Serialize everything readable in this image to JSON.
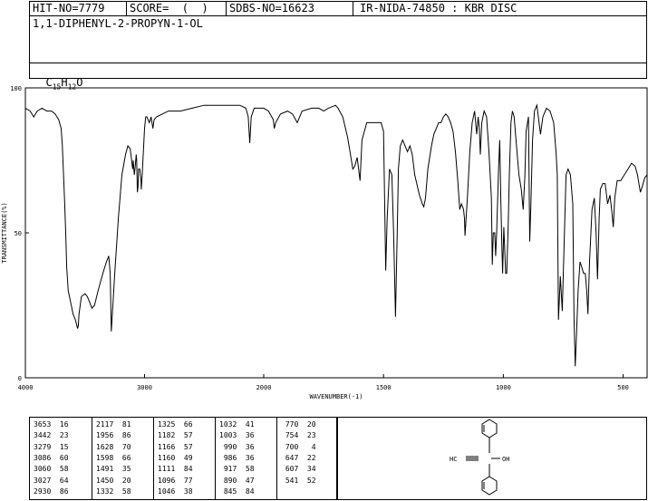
{
  "header": {
    "hit_no": "HIT-NO=7779",
    "score": "SCORE=  (  )",
    "sdbs_no": "SDBS-NO=16623",
    "method": "IR-NIDA-74850 : KBR DISC",
    "compound_name": "1,1-DIPHENYL-2-PROPYN-1-OL",
    "formula_parts": [
      "C",
      "15",
      "H",
      "12",
      "O"
    ]
  },
  "chart_data": {
    "type": "line",
    "xlabel": "WAVENUMBER(-1)",
    "ylabel": "TRANSMITTANCE(%)",
    "xlim": [
      4000,
      400
    ],
    "ylim": [
      0,
      100
    ],
    "x_ticks": [
      "4000",
      "3000",
      "2000",
      "1500",
      "1000",
      "500"
    ],
    "y_ticks": [
      "100",
      "50",
      "0"
    ],
    "series": [
      {
        "points": [
          [
            4000,
            93
          ],
          [
            3960,
            92
          ],
          [
            3930,
            90
          ],
          [
            3900,
            92
          ],
          [
            3860,
            93
          ],
          [
            3820,
            92
          ],
          [
            3780,
            92
          ],
          [
            3750,
            91
          ],
          [
            3720,
            89
          ],
          [
            3700,
            86
          ],
          [
            3690,
            80
          ],
          [
            3680,
            70
          ],
          [
            3670,
            60
          ],
          [
            3660,
            48
          ],
          [
            3653,
            38
          ],
          [
            3640,
            30
          ],
          [
            3620,
            26
          ],
          [
            3600,
            22
          ],
          [
            3580,
            20
          ],
          [
            3568,
            18
          ],
          [
            3562,
            17
          ],
          [
            3556,
            18
          ],
          [
            3550,
            22
          ],
          [
            3530,
            28
          ],
          [
            3500,
            29
          ],
          [
            3480,
            28
          ],
          [
            3460,
            26
          ],
          [
            3442,
            24
          ],
          [
            3420,
            25
          ],
          [
            3390,
            30
          ],
          [
            3350,
            36
          ],
          [
            3320,
            40
          ],
          [
            3300,
            42
          ],
          [
            3288,
            36
          ],
          [
            3279,
            16
          ],
          [
            3270,
            22
          ],
          [
            3250,
            36
          ],
          [
            3220,
            55
          ],
          [
            3190,
            70
          ],
          [
            3160,
            77
          ],
          [
            3140,
            80
          ],
          [
            3120,
            79
          ],
          [
            3100,
            72
          ],
          [
            3095,
            75
          ],
          [
            3086,
            70
          ],
          [
            3078,
            73
          ],
          [
            3070,
            77
          ],
          [
            3066,
            75
          ],
          [
            3060,
            64
          ],
          [
            3055,
            66
          ],
          [
            3050,
            72
          ],
          [
            3040,
            72
          ],
          [
            3030,
            68
          ],
          [
            3027,
            65
          ],
          [
            3020,
            70
          ],
          [
            3010,
            78
          ],
          [
            3000,
            86
          ],
          [
            2990,
            90
          ],
          [
            2980,
            90
          ],
          [
            2960,
            88
          ],
          [
            2945,
            90
          ],
          [
            2930,
            86
          ],
          [
            2920,
            89
          ],
          [
            2900,
            90
          ],
          [
            2850,
            91
          ],
          [
            2800,
            92
          ],
          [
            2700,
            92
          ],
          [
            2600,
            93
          ],
          [
            2500,
            94
          ],
          [
            2400,
            94
          ],
          [
            2300,
            94
          ],
          [
            2200,
            94
          ],
          [
            2150,
            93
          ],
          [
            2130,
            90
          ],
          [
            2117,
            81
          ],
          [
            2105,
            90
          ],
          [
            2080,
            93
          ],
          [
            2050,
            93
          ],
          [
            2000,
            93
          ],
          [
            1980,
            92
          ],
          [
            1960,
            89
          ],
          [
            1956,
            86
          ],
          [
            1950,
            88
          ],
          [
            1930,
            91
          ],
          [
            1900,
            92
          ],
          [
            1880,
            91
          ],
          [
            1860,
            88
          ],
          [
            1840,
            92
          ],
          [
            1800,
            93
          ],
          [
            1770,
            93
          ],
          [
            1750,
            92
          ],
          [
            1730,
            93
          ],
          [
            1700,
            94
          ],
          [
            1690,
            93
          ],
          [
            1670,
            90
          ],
          [
            1650,
            83
          ],
          [
            1640,
            78
          ],
          [
            1628,
            72
          ],
          [
            1620,
            73
          ],
          [
            1610,
            76
          ],
          [
            1598,
            68
          ],
          [
            1590,
            82
          ],
          [
            1570,
            88
          ],
          [
            1540,
            88
          ],
          [
            1510,
            88
          ],
          [
            1500,
            85
          ],
          [
            1491,
            37
          ],
          [
            1485,
            55
          ],
          [
            1475,
            72
          ],
          [
            1465,
            70
          ],
          [
            1458,
            50
          ],
          [
            1450,
            21
          ],
          [
            1443,
            50
          ],
          [
            1438,
            72
          ],
          [
            1430,
            80
          ],
          [
            1420,
            82
          ],
          [
            1400,
            78
          ],
          [
            1390,
            80
          ],
          [
            1380,
            77
          ],
          [
            1370,
            70
          ],
          [
            1350,
            63
          ],
          [
            1338,
            60
          ],
          [
            1332,
            59
          ],
          [
            1325,
            62
          ],
          [
            1315,
            72
          ],
          [
            1300,
            80
          ],
          [
            1290,
            84
          ],
          [
            1280,
            86
          ],
          [
            1270,
            88
          ],
          [
            1260,
            88
          ],
          [
            1250,
            90
          ],
          [
            1240,
            91
          ],
          [
            1230,
            90
          ],
          [
            1220,
            88
          ],
          [
            1210,
            85
          ],
          [
            1200,
            78
          ],
          [
            1190,
            68
          ],
          [
            1182,
            58
          ],
          [
            1175,
            60
          ],
          [
            1170,
            59
          ],
          [
            1166,
            58
          ],
          [
            1162,
            55
          ],
          [
            1160,
            49
          ],
          [
            1150,
            62
          ],
          [
            1140,
            78
          ],
          [
            1130,
            88
          ],
          [
            1120,
            92
          ],
          [
            1111,
            84
          ],
          [
            1105,
            90
          ],
          [
            1100,
            86
          ],
          [
            1096,
            77
          ],
          [
            1090,
            88
          ],
          [
            1080,
            92
          ],
          [
            1070,
            90
          ],
          [
            1060,
            78
          ],
          [
            1050,
            62
          ],
          [
            1046,
            39
          ],
          [
            1042,
            50
          ],
          [
            1036,
            50
          ],
          [
            1032,
            42
          ],
          [
            1028,
            50
          ],
          [
            1020,
            72
          ],
          [
            1015,
            82
          ],
          [
            1010,
            60
          ],
          [
            1006,
            45
          ],
          [
            1003,
            36
          ],
          [
            998,
            52
          ],
          [
            990,
            36
          ],
          [
            986,
            36
          ],
          [
            980,
            52
          ],
          [
            975,
            70
          ],
          [
            968,
            88
          ],
          [
            962,
            92
          ],
          [
            955,
            90
          ],
          [
            945,
            80
          ],
          [
            935,
            70
          ],
          [
            925,
            65
          ],
          [
            917,
            58
          ],
          [
            910,
            70
          ],
          [
            905,
            85
          ],
          [
            895,
            90
          ],
          [
            890,
            47
          ],
          [
            885,
            60
          ],
          [
            878,
            82
          ],
          [
            870,
            92
          ],
          [
            860,
            94
          ],
          [
            845,
            84
          ],
          [
            835,
            90
          ],
          [
            820,
            93
          ],
          [
            805,
            92
          ],
          [
            790,
            88
          ],
          [
            780,
            78
          ],
          [
            775,
            70
          ],
          [
            770,
            20
          ],
          [
            762,
            35
          ],
          [
            754,
            23
          ],
          [
            745,
            50
          ],
          [
            738,
            70
          ],
          [
            730,
            72
          ],
          [
            720,
            70
          ],
          [
            710,
            60
          ],
          [
            705,
            20
          ],
          [
            700,
            4
          ],
          [
            695,
            14
          ],
          [
            688,
            30
          ],
          [
            680,
            40
          ],
          [
            672,
            38
          ],
          [
            665,
            36
          ],
          [
            658,
            36
          ],
          [
            652,
            30
          ],
          [
            647,
            22
          ],
          [
            640,
            40
          ],
          [
            630,
            58
          ],
          [
            620,
            62
          ],
          [
            613,
            50
          ],
          [
            607,
            34
          ],
          [
            600,
            55
          ],
          [
            595,
            65
          ],
          [
            585,
            67
          ],
          [
            575,
            67
          ],
          [
            565,
            60
          ],
          [
            555,
            63
          ],
          [
            548,
            58
          ],
          [
            541,
            52
          ],
          [
            535,
            62
          ],
          [
            525,
            68
          ],
          [
            510,
            68
          ],
          [
            495,
            70
          ],
          [
            480,
            72
          ],
          [
            465,
            74
          ],
          [
            450,
            73
          ],
          [
            440,
            70
          ],
          [
            432,
            66
          ],
          [
            428,
            64
          ],
          [
            420,
            66
          ],
          [
            410,
            69
          ],
          [
            400,
            70
          ]
        ]
      }
    ]
  },
  "peak_table": {
    "columns": [
      [
        [
          "3653",
          "16"
        ],
        [
          "3442",
          "23"
        ],
        [
          "3279",
          "15"
        ],
        [
          "3086",
          "60"
        ],
        [
          "3060",
          "58"
        ],
        [
          "3027",
          "64"
        ],
        [
          "2930",
          "86"
        ]
      ],
      [
        [
          "2117",
          "81"
        ],
        [
          "1956",
          "86"
        ],
        [
          "1628",
          "70"
        ],
        [
          "1598",
          "66"
        ],
        [
          "1491",
          "35"
        ],
        [
          "1450",
          "20"
        ],
        [
          "1332",
          "58"
        ]
      ],
      [
        [
          "1325",
          "66"
        ],
        [
          "1182",
          "57"
        ],
        [
          "1166",
          "57"
        ],
        [
          "1160",
          "49"
        ],
        [
          "1111",
          "84"
        ],
        [
          "1096",
          "77"
        ],
        [
          "1046",
          "38"
        ]
      ],
      [
        [
          "1032",
          "41"
        ],
        [
          "1003",
          "36"
        ],
        [
          " 990",
          "36"
        ],
        [
          " 986",
          "36"
        ],
        [
          " 917",
          "58"
        ],
        [
          " 890",
          "47"
        ],
        [
          " 845",
          "84"
        ]
      ],
      [
        [
          " 770",
          "20"
        ],
        [
          " 754",
          "23"
        ],
        [
          " 700",
          " 4"
        ],
        [
          " 647",
          "22"
        ],
        [
          " 607",
          "34"
        ],
        [
          " 541",
          "52"
        ],
        [
          "",
          ""
        ]
      ]
    ]
  },
  "structure": {
    "left_label": "HC",
    "right_label": "OH"
  }
}
